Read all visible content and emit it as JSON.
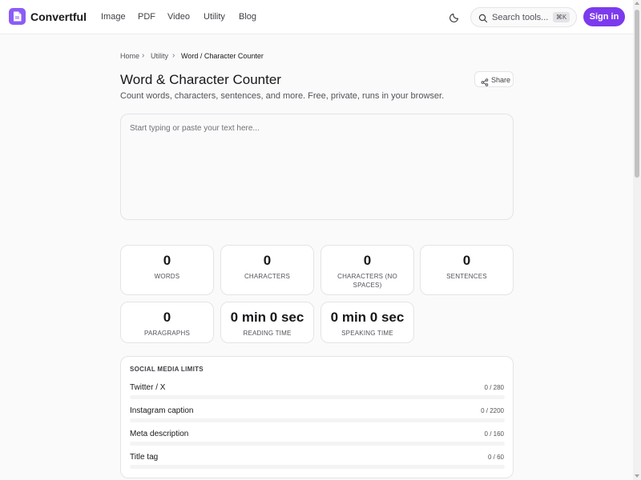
{
  "app": {
    "name": "Convertful"
  },
  "nav": {
    "items": [
      "Image",
      "PDF",
      "Video",
      "Utility",
      "Blog"
    ]
  },
  "search": {
    "placeholder": "Search tools...",
    "shortcut": "⌘K"
  },
  "auth": {
    "signin_label": "Sign in"
  },
  "breadcrumb": {
    "items": [
      "Home",
      "Utility",
      "Word / Character Counter"
    ]
  },
  "page": {
    "title": "Word & Character Counter",
    "subtitle": "Count words, characters, sentences, and more. Free, private, runs in your browser.",
    "share_label": "Share"
  },
  "editor": {
    "placeholder": "Start typing or paste your text here...",
    "value": ""
  },
  "stats": [
    {
      "value": "0",
      "label": "Words"
    },
    {
      "value": "0",
      "label": "Characters"
    },
    {
      "value": "0",
      "label": "Characters (no spaces)"
    },
    {
      "value": "0",
      "label": "Sentences"
    },
    {
      "value": "0",
      "label": "Paragraphs"
    },
    {
      "value": "0 min 0 sec",
      "label": "Reading time"
    },
    {
      "value": "0 min 0 sec",
      "label": "Speaking time"
    }
  ],
  "social": {
    "title": "SOCIAL MEDIA LIMITS",
    "limits": [
      {
        "name": "Twitter / X",
        "count": "0 / 280",
        "fill": 0
      },
      {
        "name": "Instagram caption",
        "count": "0 / 2200",
        "fill": 0
      },
      {
        "name": "Meta description",
        "count": "0 / 160",
        "fill": 0
      },
      {
        "name": "Title tag",
        "count": "0 / 60",
        "fill": 0
      }
    ]
  },
  "colors": {
    "accent": "#7c3aed",
    "logo": "#8b5cf6"
  },
  "icons": [
    "document-icon",
    "moon-icon",
    "search-icon",
    "share-icon",
    "chevron-right-icon"
  ]
}
